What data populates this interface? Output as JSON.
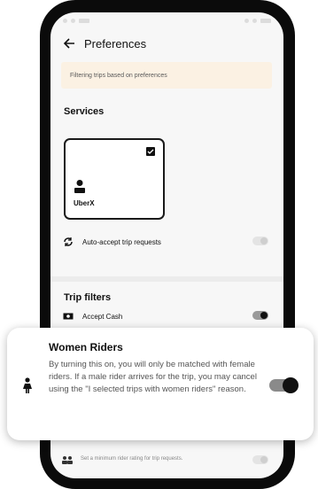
{
  "header": {
    "title": "Preferences"
  },
  "banner": {
    "text": "Filtering trips based on preferences"
  },
  "services": {
    "title": "Services",
    "card": {
      "label": "UberX",
      "selected": true
    }
  },
  "auto_accept": {
    "label": "Auto-accept trip requests",
    "enabled": false
  },
  "trip_filters": {
    "title": "Trip filters",
    "accept_cash": {
      "label": "Accept Cash",
      "enabled": true
    }
  },
  "popup": {
    "title": "Women Riders",
    "description": "By turning this on, you will only be matched with female riders. If a male rider arrives for the trip, you may cancel using the \"I selected trips with women riders\" reason.",
    "enabled": true
  },
  "rider_rating": {
    "text": "Set a minimum rider rating for trip requests."
  },
  "colors": {
    "banner_bg": "#fbf1e3",
    "accent": "#111111"
  }
}
